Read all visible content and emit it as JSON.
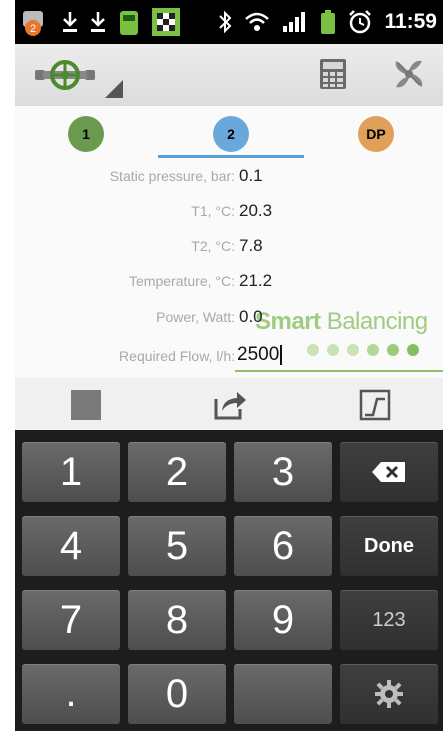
{
  "status_bar": {
    "notification_count": "2",
    "time": "11:59"
  },
  "toolbar": {
    "logo_icon": "valve-logo-icon",
    "calculator_icon": "calculator-icon",
    "settings_icon": "fan-settings-icon"
  },
  "tabs": [
    {
      "label": "1",
      "color": "#6a9a4e"
    },
    {
      "label": "2",
      "color": "#6aa8db",
      "selected": true
    },
    {
      "label": "DP",
      "color": "#e0a05a"
    }
  ],
  "fields": [
    {
      "label": "Static pressure, bar:",
      "value": "0.1"
    },
    {
      "label": "T1, °C:",
      "value": "20.3"
    },
    {
      "label": "T2, °C:",
      "value": "7.8"
    },
    {
      "label": "Temperature, °C:",
      "value": "21.2"
    },
    {
      "label": "Power, Watt:",
      "value": "0.0"
    }
  ],
  "required_flow": {
    "label": "Required Flow, l/h:",
    "value": "2500"
  },
  "brand": {
    "bold": "Smart",
    "light": "Balancing"
  },
  "keyboard": {
    "keys": [
      "1",
      "2",
      "3",
      "4",
      "5",
      "6",
      "7",
      "8",
      "9",
      ".",
      "0"
    ],
    "done_label": "Done",
    "mode_label": "123"
  }
}
